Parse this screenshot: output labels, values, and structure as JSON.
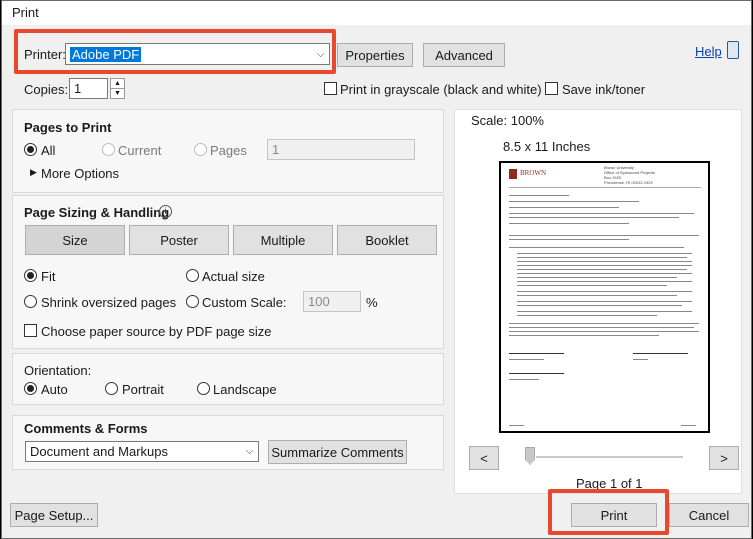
{
  "window": {
    "title": "Print"
  },
  "printer": {
    "label": "Printer:",
    "selected": "Adobe PDF"
  },
  "buttons": {
    "properties": "Properties",
    "advanced": "Advanced",
    "help": "Help"
  },
  "copies": {
    "label": "Copies:",
    "value": "1"
  },
  "options": {
    "grayscale": "Print in grayscale (black and white)",
    "save_ink": "Save ink/toner"
  },
  "pages_to_print": {
    "title": "Pages to Print",
    "all": "All",
    "current": "Current",
    "pages": "Pages",
    "pages_value": "1",
    "more_options": "More Options"
  },
  "sizing": {
    "title": "Page Sizing & Handling",
    "tabs": [
      "Size",
      "Poster",
      "Multiple",
      "Booklet"
    ],
    "fit": "Fit",
    "actual_size": "Actual size",
    "shrink": "Shrink oversized pages",
    "custom_scale": "Custom Scale:",
    "custom_scale_value": "100",
    "percent": "%",
    "choose_source": "Choose paper source by PDF page size"
  },
  "orientation": {
    "title": "Orientation:",
    "auto": "Auto",
    "portrait": "Portrait",
    "landscape": "Landscape"
  },
  "comments": {
    "title": "Comments & Forms",
    "selected": "Document and Markups",
    "summarize": "Summarize Comments"
  },
  "preview": {
    "scale": "Scale: 100%",
    "paper": "8.5 x 11 Inches",
    "page_info": "Page 1 of 1",
    "prev": "<",
    "next": ">",
    "doc_logo": "BROWN",
    "doc_header_right": [
      "Brown University",
      "Office of Sponsored Projects",
      "Box 1929",
      "Providence, RI 02912-1929"
    ]
  },
  "footer": {
    "page_setup": "Page Setup...",
    "print": "Print",
    "cancel": "Cancel"
  }
}
